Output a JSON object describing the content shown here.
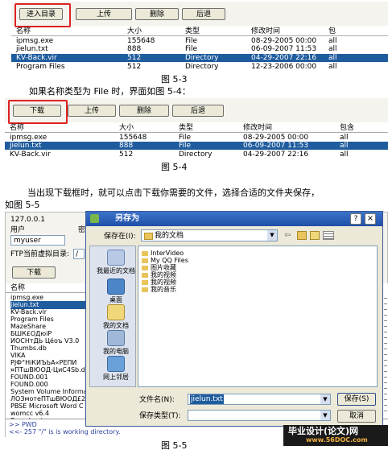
{
  "figure1": {
    "buttons": [
      "进入目录",
      "上传",
      "删除",
      "后退"
    ],
    "headers": [
      "名称",
      "大小",
      "类型",
      "修改时间",
      "包"
    ],
    "rows": [
      [
        "ipmsg.exe",
        "155648",
        "File",
        "08-29-2005 00:00",
        "all"
      ],
      [
        "jielun.txt",
        "888",
        "File",
        "06-09-2007 11:53",
        "all"
      ],
      [
        "KV-Back.vir",
        "512",
        "Directory",
        "04-29-2007 22:16",
        "all"
      ],
      [
        "Program Files",
        "512",
        "Directory",
        "12-23-2006 00:00",
        "all"
      ]
    ],
    "caption": "图 5-3"
  },
  "text1": "如果名称类型为 File 时，界面如图 5-4：",
  "figure2": {
    "buttons": [
      "下载",
      "上传",
      "删除",
      "后退"
    ],
    "headers": [
      "名称",
      "大小",
      "类型",
      "修改时间",
      "包含"
    ],
    "rows": [
      [
        "ipmsg.exe",
        "155648",
        "File",
        "08-29-2005 00:00",
        "all"
      ],
      [
        "jielun.txt",
        "888",
        "File",
        "06-09-2007 11:53",
        "all"
      ],
      [
        "KV-Back.vir",
        "512",
        "Directory",
        "04-29-2007 22:16",
        "all"
      ]
    ],
    "caption": "图 5-4"
  },
  "text2": "当出现下载框时，就可以点击下载你需要的文件，选择合适的文件夹保存，",
  "text3": "如图 5-5",
  "figure3": {
    "ip": "127.0.0.1",
    "user_label": "用户",
    "pass_label": "密",
    "user_value": "myuser",
    "ftp_dir_label": "FTP当前虚拟目录:",
    "ftp_dir_value": "/",
    "download_button": "下载",
    "name_header": "名称",
    "list": [
      "ipmsg.exe",
      "jielun.txt",
      "KV-Back.vir",
      "Program Files",
      "MazeShare",
      "БШК£ОДюіР",
      "ИОСНтДЬ Цёоъ V3.0",
      "Thumbs.db",
      "VIKA",
      "РЈФ°НіКИЪЬА«РЕПИ",
      "¤ПТшВЮОД-ЦиС4Sb.d",
      "FOUND.001",
      "FOUND.000",
      "System Volume Informa",
      "ЛОЗмотеПТшВЮОД£2",
      "PBSE Microsoft Word C",
      "womcc v6.4",
      "Download"
    ],
    "log": [
      ">> PWD",
      "<<- 257 \"/\" is is working directory."
    ],
    "caption": "图 5-5",
    "dialog": {
      "title": "另存为",
      "save_in_label": "保存在(I):",
      "save_in_value": "我的文档",
      "nav": [
        "我最近的文档",
        "桌面",
        "我的文档",
        "我的电脑",
        "网上邻居"
      ],
      "files": [
        "InterVideo",
        "My QQ Files",
        "图片收藏",
        "我的视频",
        "我的视频",
        "我的音乐"
      ],
      "filename_label": "文件名(N):",
      "filename_value": "jielun.txt",
      "filetype_label": "保存类型(T):",
      "filetype_value": "",
      "save_button": "保存(S)",
      "cancel_button": "取消",
      "help_glyph": "?",
      "close_glyph": "×"
    }
  },
  "watermark": {
    "line1": "毕业设计(论文)网",
    "line2": "www.56DOC.com"
  },
  "colors": {
    "selection": "#1f5c9e",
    "dialog_title": "#1f4fa8",
    "highlight_box": "#dd2222",
    "watermark_bg": "#1a1a1a"
  }
}
